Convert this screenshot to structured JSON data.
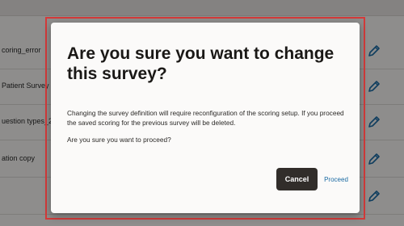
{
  "background_list": {
    "rows": [
      {
        "name": "coring_error",
        "edit_icon": "pencil-icon"
      },
      {
        "name": "Patient Survey",
        "edit_icon": "pencil-icon"
      },
      {
        "name": "uestion types_2",
        "edit_icon": "pencil-icon"
      },
      {
        "name": "ation copy",
        "edit_icon": "pencil-icon"
      },
      {
        "name": "",
        "edit_icon": "pencil-icon"
      }
    ]
  },
  "dialog": {
    "title": "Are you sure you want to change this survey?",
    "body": "Changing the survey definition will require reconfiguration of the scoring setup. If you proceed the saved scoring for the previous survey will be deleted.",
    "question": "Are you sure you want to proceed?",
    "cancel_label": "Cancel",
    "proceed_label": "Proceed"
  },
  "colors": {
    "focus_outline": "#d43a3a",
    "cancel_bg": "#312d2a",
    "proceed_link": "#1a6aa3",
    "edit_icon": "#1a6aa3"
  }
}
